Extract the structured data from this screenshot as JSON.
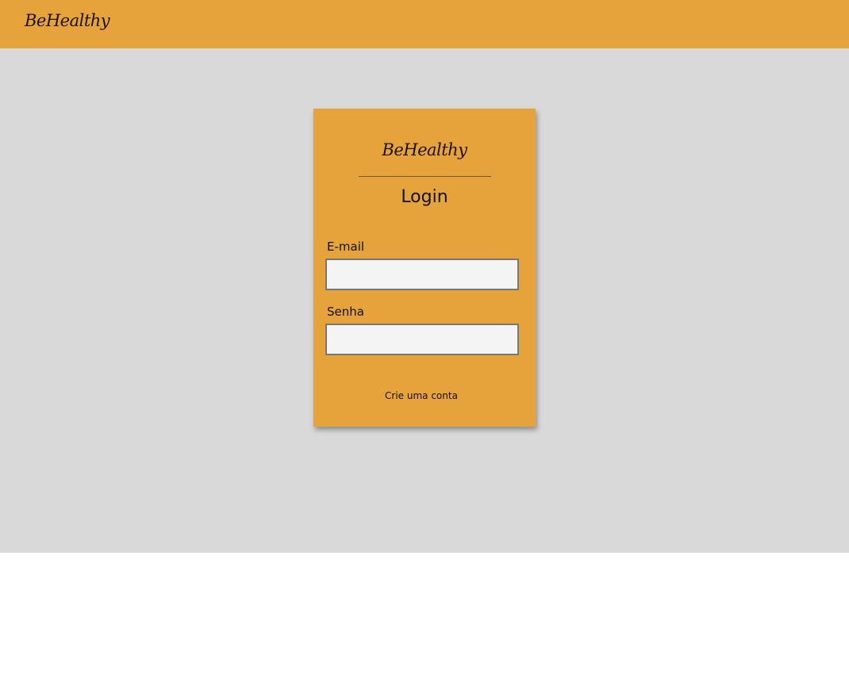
{
  "header": {
    "logo": "BeHealthy"
  },
  "login_card": {
    "logo": "BeHealthy",
    "title": "Login",
    "email": {
      "label": "E-mail",
      "value": "",
      "placeholder": ""
    },
    "password": {
      "label": "Senha",
      "value": "",
      "placeholder": ""
    },
    "signup_link": "Crie uma conta"
  },
  "colors": {
    "header_bg": "#e7a33b",
    "card_bg": "#e7a33b",
    "page_bg": "#d9d9d9",
    "input_bg": "#f4f4f4",
    "input_border": "#777777"
  }
}
